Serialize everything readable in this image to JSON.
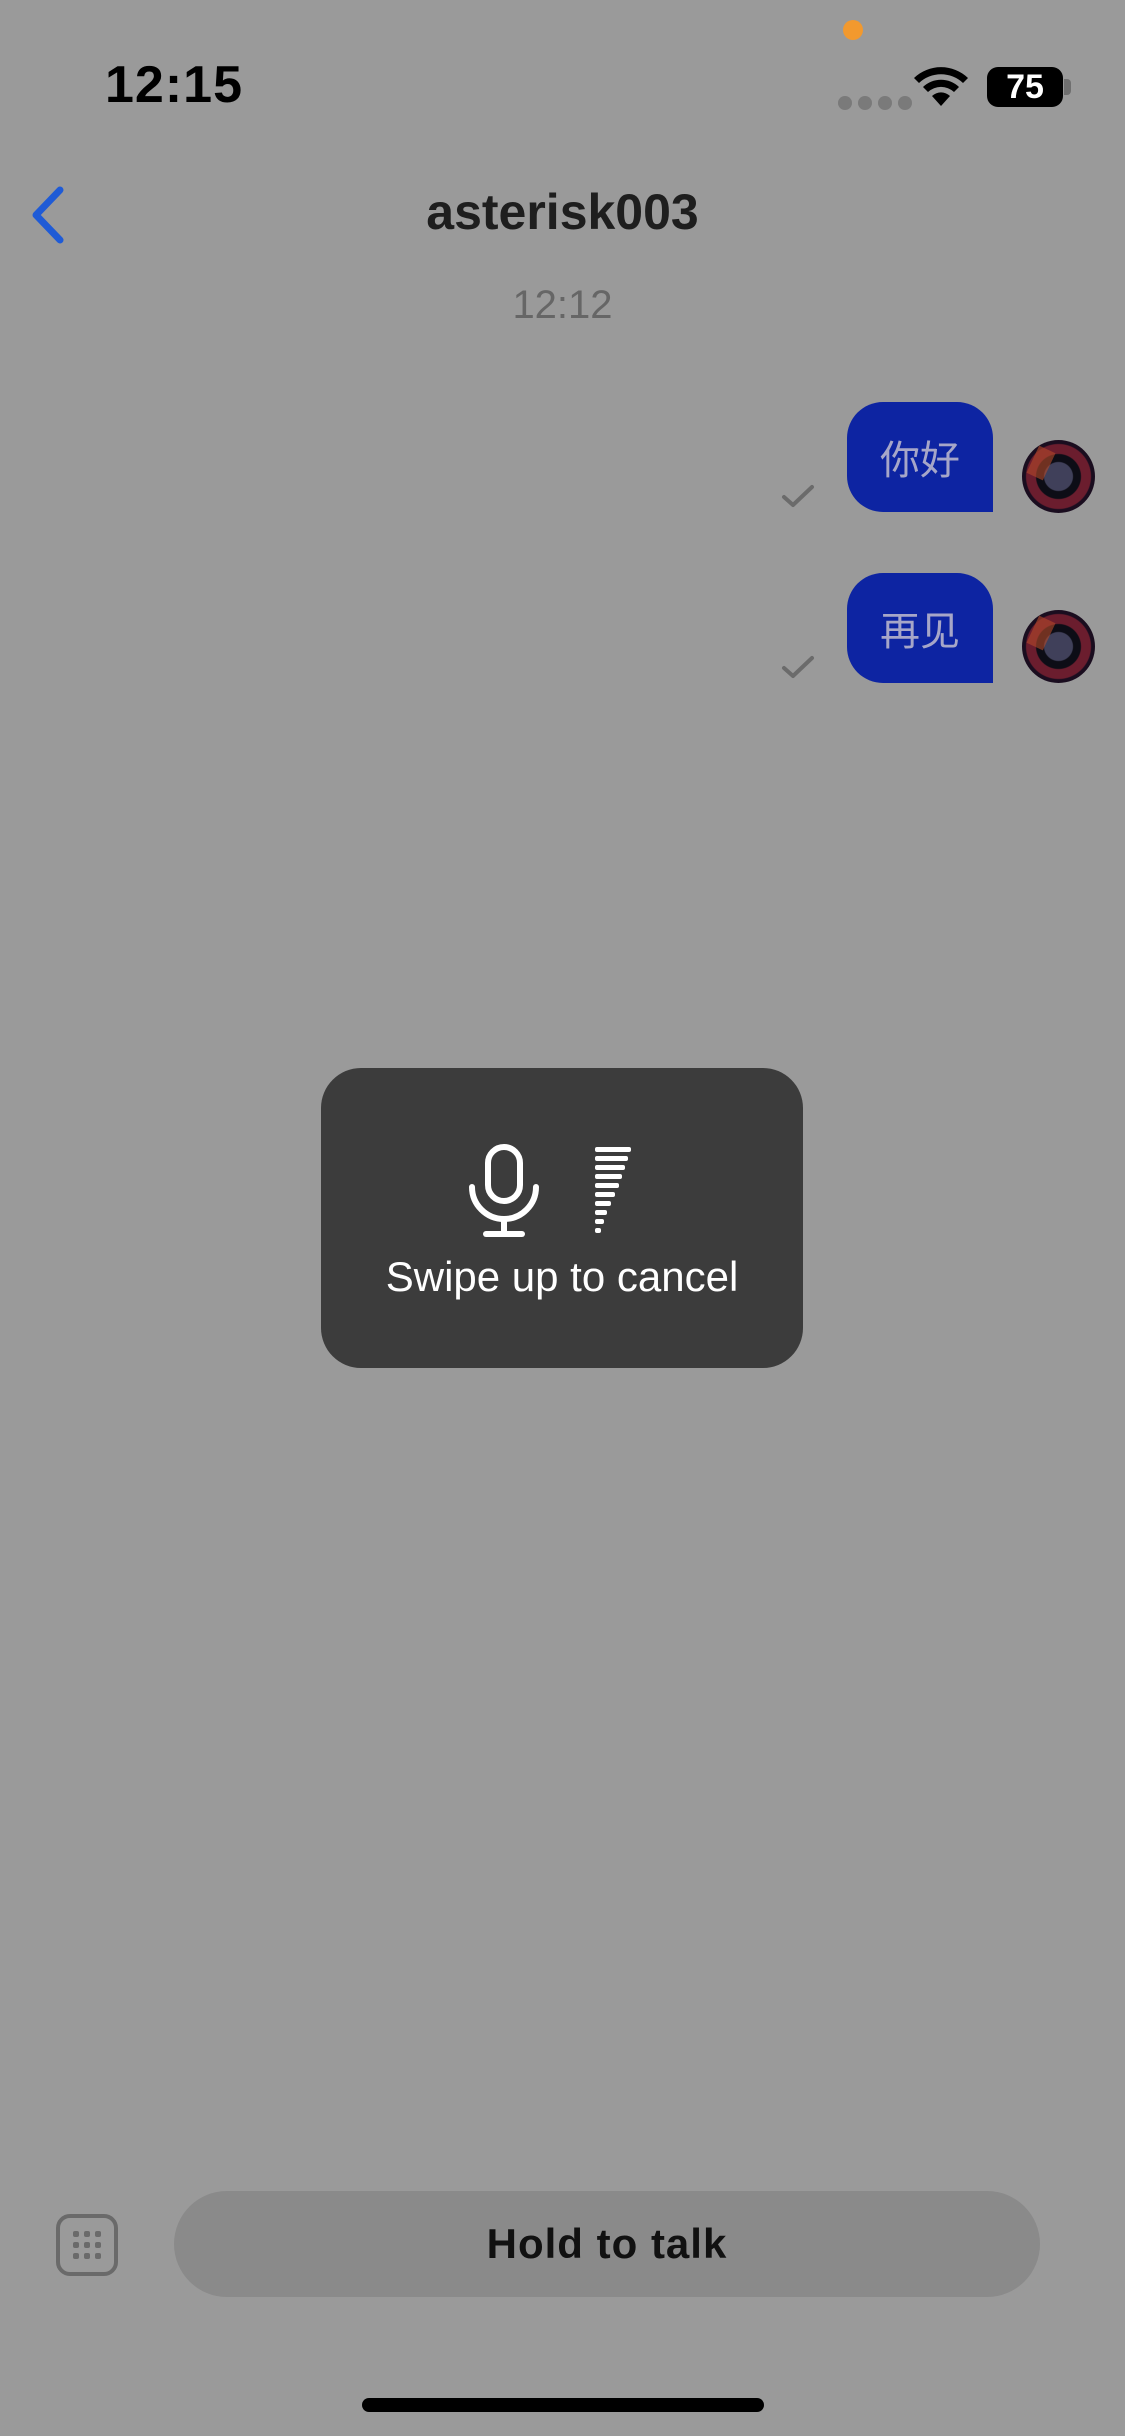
{
  "status_bar": {
    "time": "12:15",
    "battery": "75",
    "icons": [
      "signal-dots-icon",
      "wifi-icon",
      "battery-icon"
    ]
  },
  "nav": {
    "back_icon": "chevron-left-icon",
    "title": "asterisk003"
  },
  "conversation": {
    "timestamp": "12:12",
    "messages": [
      {
        "text": "你好",
        "sender": "me",
        "status": "sent"
      },
      {
        "text": "再见",
        "sender": "me",
        "status": "sent"
      }
    ]
  },
  "recording_overlay": {
    "hint": "Swipe up to cancel",
    "icons": [
      "microphone-icon",
      "volume-level-icon"
    ]
  },
  "input_bar": {
    "keyboard_icon": "keyboard-icon",
    "hold_label": "Hold to talk"
  },
  "colors": {
    "background": "#9a9a9a",
    "bubble": "#0d24a2",
    "accent": "#1f5bd6",
    "overlay": "#3c3c3c"
  }
}
